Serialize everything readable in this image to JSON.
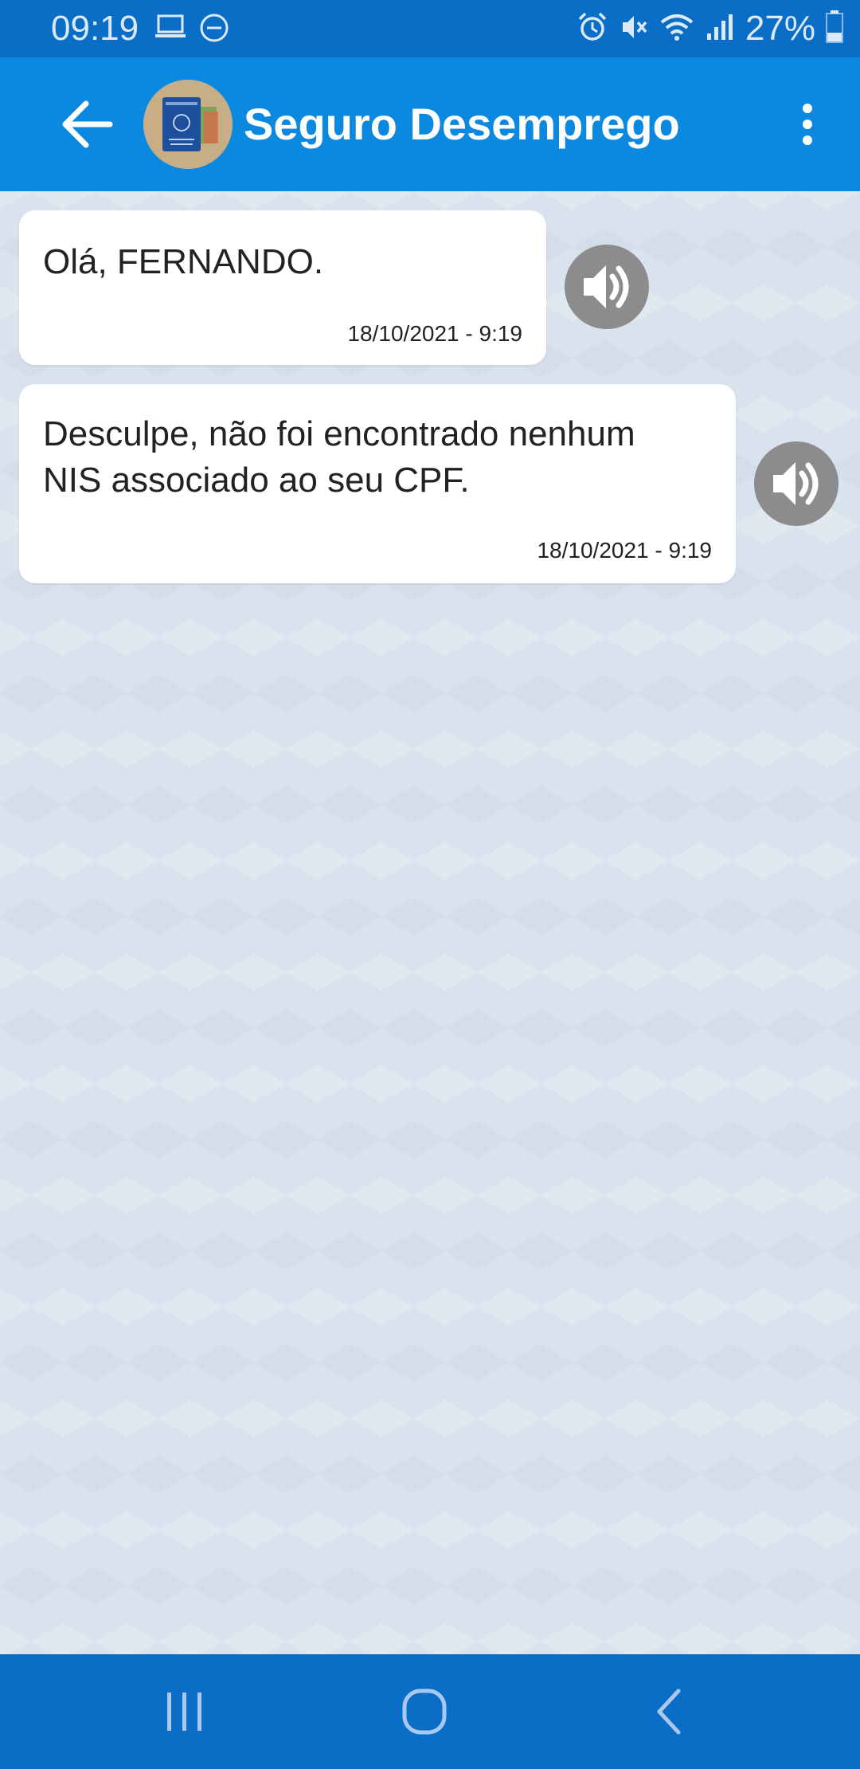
{
  "status_bar": {
    "time": "09:19",
    "battery": "27%",
    "icons": [
      "laptop-icon",
      "dnd-icon",
      "alarm-icon",
      "mute-icon",
      "wifi-icon",
      "signal-icon",
      "battery-icon"
    ]
  },
  "header": {
    "title": "Seguro Desemprego",
    "back_icon": "arrow-left-icon",
    "menu_icon": "more-vert-icon"
  },
  "messages": [
    {
      "text_lines": [
        "Olá, FERNANDO."
      ],
      "timestamp": "18/10/2021 - 9:19"
    },
    {
      "text_lines": [
        "Desculpe, não foi encontrado nenhum",
        "NIS associado ao seu CPF."
      ],
      "timestamp": "18/10/2021 - 9:19"
    }
  ],
  "nav_bar": {
    "buttons": [
      "recent-apps-icon",
      "home-icon",
      "back-icon"
    ]
  },
  "colors": {
    "status_bar": "#0a6ec7",
    "app_bar": "#0b88df",
    "chat_background": "#d9e3ed",
    "speaker_button": "#8c8c8c"
  }
}
